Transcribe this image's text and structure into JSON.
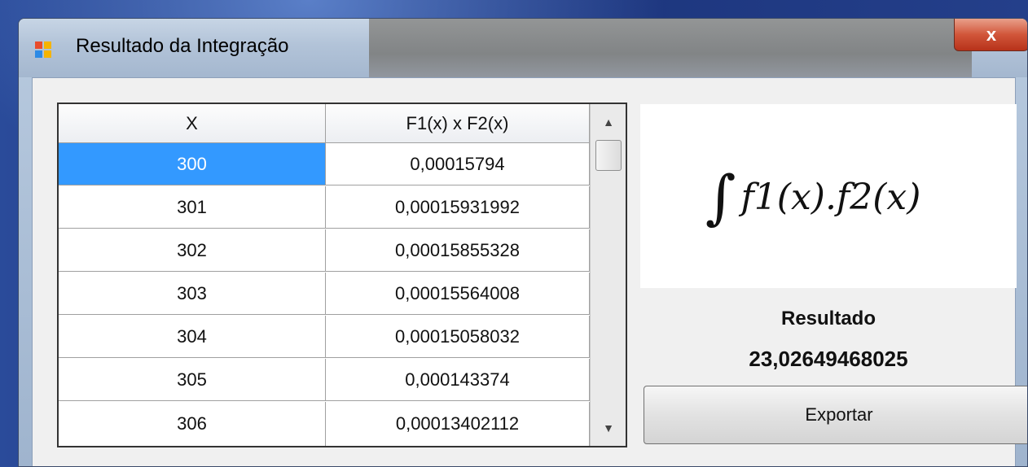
{
  "window": {
    "title": "Resultado da Integração",
    "close_label": "x"
  },
  "grid": {
    "columns": [
      "X",
      "F1(x) x F2(x)"
    ],
    "rows": [
      {
        "x": "300",
        "f": "0,00015794",
        "selected": true
      },
      {
        "x": "301",
        "f": "0,00015931992"
      },
      {
        "x": "302",
        "f": "0,00015855328"
      },
      {
        "x": "303",
        "f": "0,00015564008"
      },
      {
        "x": "304",
        "f": "0,00015058032"
      },
      {
        "x": "305",
        "f": "0,000143374"
      },
      {
        "x": "306",
        "f": "0,00013402112"
      }
    ]
  },
  "formula": {
    "integral_sign": "∫",
    "expression": "f1(x).f2(x)"
  },
  "result": {
    "label": "Resultado",
    "value": "23,02649468025"
  },
  "export_label": "Exportar",
  "colors": {
    "selection": "#3399ff",
    "close_button": "#c8462a"
  },
  "icons": {
    "app": "app-window-icon",
    "scroll_up": "scroll-up-arrow-icon",
    "scroll_down": "scroll-down-arrow-icon"
  }
}
